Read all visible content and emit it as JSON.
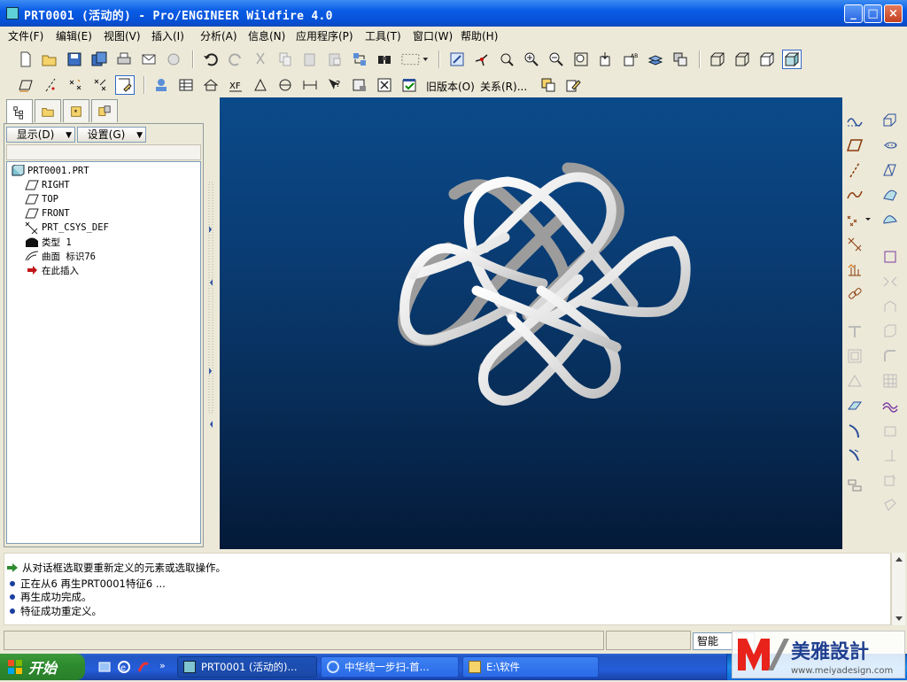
{
  "window": {
    "title": "PRT0001 (活动的) - Pro/ENGINEER Wildfire 4.0",
    "controls": {
      "minimize": "_",
      "maximize": "□",
      "close": "×"
    }
  },
  "menu": [
    "文件(F)",
    "编辑(E)",
    "视图(V)",
    "插入(I)",
    "分析(A)",
    "信息(N)",
    "应用程序(P)",
    "工具(T)",
    "窗口(W)",
    "帮助(H)"
  ],
  "toolbar2": {
    "legacy_label": "旧版本(O)",
    "relations_label": "关系(R)..."
  },
  "model_panel": {
    "display_button": "显示(D)",
    "settings_button": "设置(G)",
    "tree": [
      {
        "label": "PRT0001.PRT",
        "icon": "part-icon"
      },
      {
        "label": "RIGHT",
        "icon": "datum-plane-icon"
      },
      {
        "label": "TOP",
        "icon": "datum-plane-icon"
      },
      {
        "label": "FRONT",
        "icon": "datum-plane-icon"
      },
      {
        "label": "PRT_CSYS_DEF",
        "icon": "csys-icon"
      },
      {
        "label": "类型 1",
        "icon": "sweep-icon"
      },
      {
        "label": "曲面 标识76",
        "icon": "surface-icon"
      },
      {
        "label": "在此插入",
        "icon": "insert-arrow-icon"
      }
    ]
  },
  "messages": [
    {
      "text": "从对话框选取要重新定义的元素或选取操作。",
      "type": "prompt"
    },
    {
      "text": "正在从6 再生PRT0001特征6 ...",
      "type": "info"
    },
    {
      "text": "再生成功完成。",
      "type": "info"
    },
    {
      "text": "特征成功重定义。",
      "type": "info"
    }
  ],
  "status": {
    "filter": "智能"
  },
  "taskbar": {
    "start": "开始",
    "tasks": [
      "PRT0001 (活动的)...",
      "中华结一步扫-首...",
      "E:\\软件"
    ],
    "tray_text": "www.meiyadesign.com"
  },
  "watermark": {
    "text": "美雅設計"
  },
  "colors": {
    "canvas_top": "#0b4a8a",
    "canvas_bottom": "#041a38",
    "knot": "#ffffff",
    "title_bar": "#0a5ce6"
  }
}
